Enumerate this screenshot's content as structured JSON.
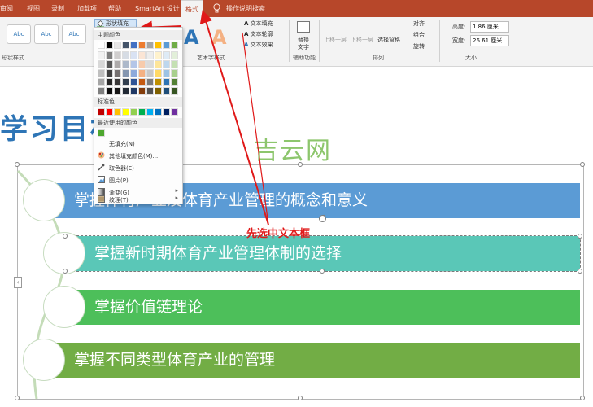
{
  "tabs": [
    {
      "id": "review",
      "label": "审阅"
    },
    {
      "id": "view",
      "label": "视图"
    },
    {
      "id": "record",
      "label": "录制"
    },
    {
      "id": "addins",
      "label": "加载项"
    },
    {
      "id": "help",
      "label": "帮助"
    },
    {
      "id": "smartart",
      "label": "SmartArt 设计"
    },
    {
      "id": "format",
      "label": "格式"
    },
    {
      "id": "search",
      "label": "操作说明搜索"
    }
  ],
  "ribbon": {
    "shape_styles_label": "形状样式",
    "abc_label": "Abc",
    "shape_fill_label": "形状填充",
    "text_fill_label": "文本填充",
    "text_outline_label": "文本轮廓",
    "text_effects_label": "文本效果",
    "art_styles_label": "艺术字样式",
    "alt_text_line1": "替换",
    "alt_text_line2": "文字",
    "accessibility_label": "辅助功能",
    "bring_forward_label": "上移一层",
    "send_backward_label": "下移一层",
    "selection_pane_label": "选择窗格",
    "align_label": "对齐",
    "group_label": "组合",
    "rotate_label": "旋转",
    "arrange_label": "排列",
    "height_label": "高度:",
    "height_value": "1.86 厘米",
    "width_label": "宽度:",
    "width_value": "26.61 厘米",
    "size_label": "大小"
  },
  "dropdown": {
    "theme_colors_label": "主题颜色",
    "standard_colors_label": "标准色",
    "recent_colors_label": "最近使用的颜色",
    "no_fill": "无填充(N)",
    "more_fill_colors": "其他填充颜色(M)...",
    "eyedropper": "取色器(E)",
    "picture": "图片(P)...",
    "gradient": "渐变(G)",
    "texture": "纹理(T)"
  },
  "colors": {
    "theme_top": [
      "#ffffff",
      "#000000",
      "#e7e6e6",
      "#44546a",
      "#4472c4",
      "#ed7d31",
      "#a5a5a5",
      "#ffc000",
      "#5b9bd5",
      "#70ad47"
    ],
    "theme_shades": [
      [
        "#f2f2f2",
        "#7f7f7f",
        "#d0cece",
        "#d6dce4",
        "#d9e2f3",
        "#fbe5d5",
        "#ededed",
        "#fff2cc",
        "#deebf6",
        "#e2efd9"
      ],
      [
        "#d8d8d8",
        "#595959",
        "#aeabab",
        "#adb9ca",
        "#b4c6e7",
        "#f7cbac",
        "#dbdbdb",
        "#fee599",
        "#bdd7ee",
        "#c5e0b3"
      ],
      [
        "#bfbfbf",
        "#3f3f3f",
        "#757070",
        "#8496b0",
        "#8eaadb",
        "#f4b183",
        "#c9c9c9",
        "#ffd965",
        "#9cc3e5",
        "#a8d08d"
      ],
      [
        "#a5a5a5",
        "#262626",
        "#3a3838",
        "#323f4f",
        "#2f5496",
        "#c55a11",
        "#7b7b7b",
        "#bf9000",
        "#2e75b5",
        "#538135"
      ],
      [
        "#7f7f7f",
        "#0c0c0c",
        "#171616",
        "#222a35",
        "#1f3864",
        "#833c0b",
        "#525252",
        "#7f6000",
        "#1e4e79",
        "#375623"
      ]
    ],
    "standard": [
      "#c00000",
      "#ff0000",
      "#ffc000",
      "#ffff00",
      "#92d050",
      "#00b050",
      "#00b0f0",
      "#0070c0",
      "#002060",
      "#7030a0"
    ],
    "recent": [
      "#4ea72e"
    ],
    "tab_bar": "#b7472a",
    "bar1": "#5b9bd5",
    "bar2": "#5ac7b7",
    "bar3": "#4dbf5a",
    "bar4": "#72ad45",
    "annotation": "#e01919"
  },
  "slide": {
    "title": "学习目标",
    "watermark": "吉云网",
    "items": [
      "掌握体育产业及体育产业管理的概念和意义",
      "掌握新时期体育产业管理体制的选择",
      "掌握价值链理论",
      "掌握不同类型体育产业的管理"
    ]
  },
  "annotation_text": "先选中文本框",
  "icons": {
    "lightbulb": "lightbulb-icon",
    "paint_bucket": "paint-bucket-icon",
    "eyedropper": "eyedropper-icon",
    "palette": "palette-icon",
    "picture": "picture-icon",
    "gradient": "gradient-icon",
    "texture": "texture-icon",
    "rotate": "rotate-handle-icon"
  }
}
